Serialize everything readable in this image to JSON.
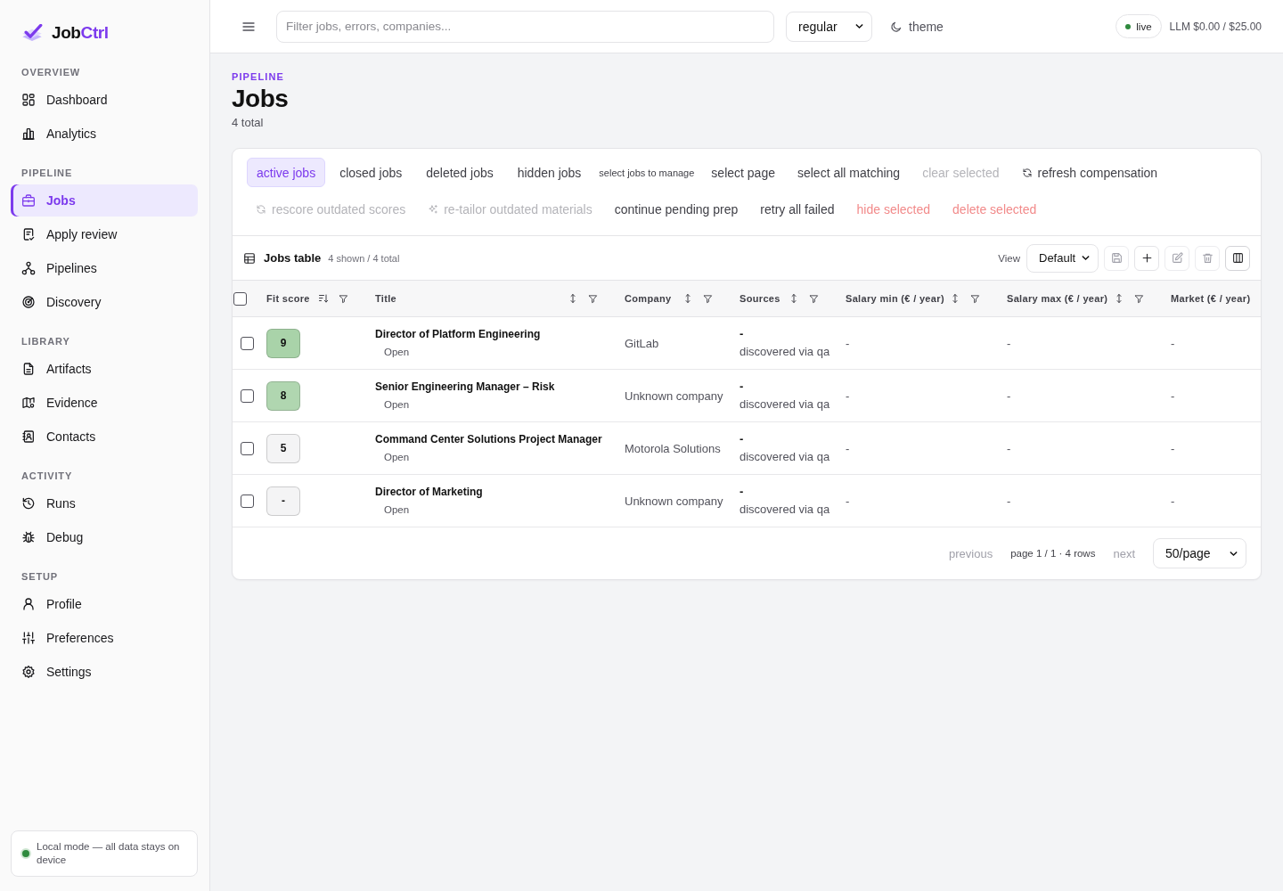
{
  "sidebar": {
    "logo": {
      "text": "Job",
      "accent": "Ctrl"
    },
    "sections": [
      {
        "title": "OVERVIEW",
        "items": [
          {
            "label": "Dashboard",
            "selected": false
          },
          {
            "label": "Analytics",
            "selected": false
          }
        ]
      },
      {
        "title": "PIPELINE",
        "items": [
          {
            "label": "Jobs",
            "selected": true
          },
          {
            "label": "Apply review",
            "selected": false
          },
          {
            "label": "Pipelines",
            "selected": false
          },
          {
            "label": "Discovery",
            "selected": false
          }
        ]
      },
      {
        "title": "LIBRARY",
        "items": [
          {
            "label": "Artifacts",
            "selected": false
          },
          {
            "label": "Evidence",
            "selected": false
          },
          {
            "label": "Contacts",
            "selected": false
          }
        ]
      },
      {
        "title": "ACTIVITY",
        "items": [
          {
            "label": "Runs",
            "selected": false
          },
          {
            "label": "Debug",
            "selected": false
          }
        ]
      },
      {
        "title": "SETUP",
        "items": [
          {
            "label": "Profile",
            "selected": false
          },
          {
            "label": "Preferences",
            "selected": false
          },
          {
            "label": "Settings",
            "selected": false
          }
        ]
      }
    ],
    "footer": {
      "text": "Local mode — all data stays on device"
    }
  },
  "topbar": {
    "search": {
      "placeholder": "Filter jobs, errors, companies..."
    },
    "mode_select": {
      "value": "regular"
    },
    "theme_button": {
      "label": "theme"
    },
    "live_badge": {
      "label": "live"
    },
    "llm_usage": "LLM $0.00 / $25.00"
  },
  "page_header": {
    "eyebrow": "PIPELINE",
    "title": "Jobs",
    "subtitle": "4 total"
  },
  "toolbar": {
    "tabs": [
      {
        "label": "active jobs",
        "selected": true
      },
      {
        "label": "closed jobs",
        "selected": false
      },
      {
        "label": "deleted jobs",
        "selected": false
      },
      {
        "label": "hidden jobs",
        "selected": false
      }
    ],
    "selection_hint": "select jobs to manage",
    "actions": [
      {
        "label": "select page",
        "kind": "normal",
        "disabled": false
      },
      {
        "label": "select all matching",
        "kind": "normal",
        "disabled": false
      },
      {
        "label": "clear selected",
        "kind": "normal",
        "disabled": true
      },
      {
        "label": "refresh compensation",
        "kind": "normal",
        "disabled": false
      },
      {
        "label": "rescore outdated scores",
        "kind": "normal",
        "disabled": true
      },
      {
        "label": "re-tailor outdated materials",
        "kind": "normal",
        "disabled": true
      },
      {
        "label": "continue pending prep",
        "kind": "normal",
        "disabled": false
      },
      {
        "label": "retry all failed",
        "kind": "normal",
        "disabled": false
      },
      {
        "label": "hide selected",
        "kind": "danger",
        "disabled": true
      },
      {
        "label": "delete selected",
        "kind": "danger",
        "disabled": true
      }
    ]
  },
  "table": {
    "title": "Jobs table",
    "count": "4 shown / 4 total",
    "view_label": "View",
    "view_select": {
      "value": "Default"
    },
    "tools": [
      {
        "disabled": true
      },
      {
        "disabled": false
      },
      {
        "disabled": true
      },
      {
        "disabled": true
      },
      {
        "disabled": false
      }
    ],
    "select_all_checked": false,
    "columns": [
      {
        "label": "Fit score",
        "sorted": true
      },
      {
        "label": "Title",
        "sorted": false
      },
      {
        "label": "Company",
        "sorted": false
      },
      {
        "label": "Sources",
        "sorted": false
      },
      {
        "label": "Salary min (€ / year)",
        "sorted": false
      },
      {
        "label": "Salary max (€ / year)",
        "sorted": false
      },
      {
        "label": "Market (€ / year)"
      }
    ],
    "rows": [
      {
        "selected": false,
        "score": {
          "text": "9",
          "color": "#a9d3a9"
        },
        "title": "Director of Platform Engineering",
        "status": "Open",
        "company": "GitLab",
        "source": "-",
        "source_note": "discovered via qa",
        "salary_min": "-",
        "salary_max": "-",
        "market": "-"
      },
      {
        "selected": false,
        "score": {
          "text": "8",
          "color": "#b0d6b0"
        },
        "title": "Senior Engineering Manager – Risk",
        "status": "Open",
        "company": "Unknown company",
        "source": "-",
        "source_note": "discovered via qa",
        "salary_min": "-",
        "salary_max": "-",
        "market": "-"
      },
      {
        "selected": false,
        "score": {
          "text": "5",
          "color": "#f4f4f5"
        },
        "title": "Command Center Solutions Project Manager",
        "status": "Open",
        "company": "Motorola Solutions",
        "source": "-",
        "source_note": "discovered via qa",
        "salary_min": "-",
        "salary_max": "-",
        "market": "-"
      },
      {
        "selected": false,
        "score": {
          "text": "-",
          "color": "#f4f4f5"
        },
        "title": "Director of Marketing",
        "status": "Open",
        "company": "Unknown company",
        "source": "-",
        "source_note": "discovered via qa",
        "salary_min": "-",
        "salary_max": "-",
        "market": "-"
      }
    ],
    "pagination": {
      "previous": {
        "label": "previous",
        "disabled": true
      },
      "info": "page 1 / 1 · 4 rows",
      "next": {
        "label": "next",
        "disabled": true
      },
      "per_page": "50/page"
    }
  }
}
